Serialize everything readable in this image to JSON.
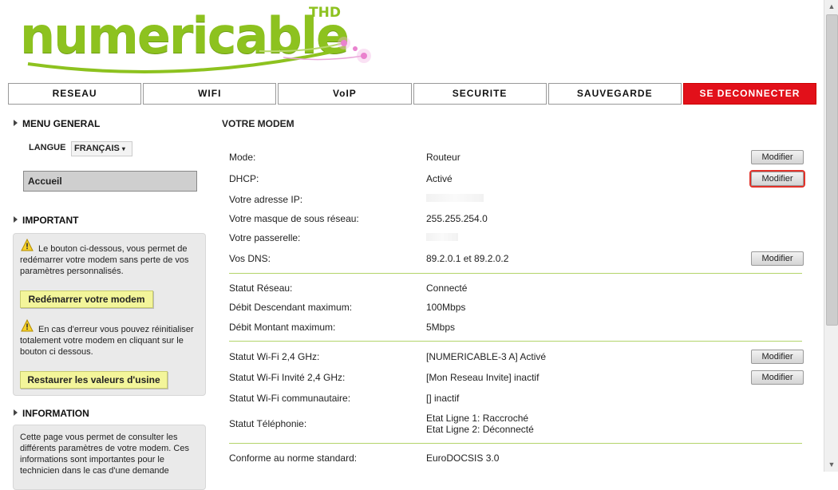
{
  "logo": {
    "brand": "numericable",
    "badge": "THD"
  },
  "nav": [
    {
      "label": "RESEAU"
    },
    {
      "label": "WIFI"
    },
    {
      "label": "VoIP"
    },
    {
      "label": "SECURITE"
    },
    {
      "label": "SAUVEGARDE"
    },
    {
      "label": "SE DECONNECTER"
    }
  ],
  "sidebar": {
    "menu_title": "MENU GENERAL",
    "lang_label": "LANGUE",
    "lang_value": "FRANÇAIS",
    "home_label": "Accueil",
    "important_title": "IMPORTANT",
    "important_text1": "Le bouton ci-dessous, vous permet de redémarrer votre modem sans perte de vos paramètres personnalisés.",
    "restart_button": "Redémarrer votre modem",
    "important_text2": "En cas d'erreur vous pouvez réinitialiser totalement votre modem en cliquant sur le bouton ci dessous.",
    "reset_button": "Restaurer les valeurs d'usine",
    "info_title": "INFORMATION",
    "info_text": "Cette page vous permet de consulter les différents paramètres de votre modem. Ces informations sont importantes pour le technicien dans le cas d'une demande"
  },
  "main": {
    "title": "VOTRE MODEM",
    "modify_label": "Modifier",
    "rows": [
      {
        "label": "Mode:",
        "value": "Routeur"
      },
      {
        "label": "DHCP:",
        "value": "Activé"
      },
      {
        "label": "Votre adresse IP:",
        "value": ""
      },
      {
        "label": "Votre masque de sous réseau:",
        "value": "255.255.254.0"
      },
      {
        "label": "Votre passerelle:",
        "value": ""
      },
      {
        "label": "Vos DNS:",
        "value": "89.2.0.1 et 89.2.0.2"
      },
      {
        "label": "Statut Réseau:",
        "value": "Connecté"
      },
      {
        "label": "Débit Descendant maximum:",
        "value": "100Mbps"
      },
      {
        "label": "Débit Montant maximum:",
        "value": "5Mbps"
      },
      {
        "label": "Statut Wi-Fi 2,4 GHz:",
        "value": "[NUMERICABLE-3    A] Activé"
      },
      {
        "label": "Statut Wi-Fi Invité 2,4 GHz:",
        "value": "[Mon Reseau Invite] inactif"
      },
      {
        "label": "Statut Wi-Fi communautaire:",
        "value": "[] inactif"
      },
      {
        "label": "Statut Téléphonie:",
        "value": "Etat Ligne 1: Raccroché",
        "value2": "Etat Ligne 2: Déconnecté"
      },
      {
        "label": "Conforme au norme standard:",
        "value": "EuroDOCSIS 3.0"
      }
    ]
  }
}
